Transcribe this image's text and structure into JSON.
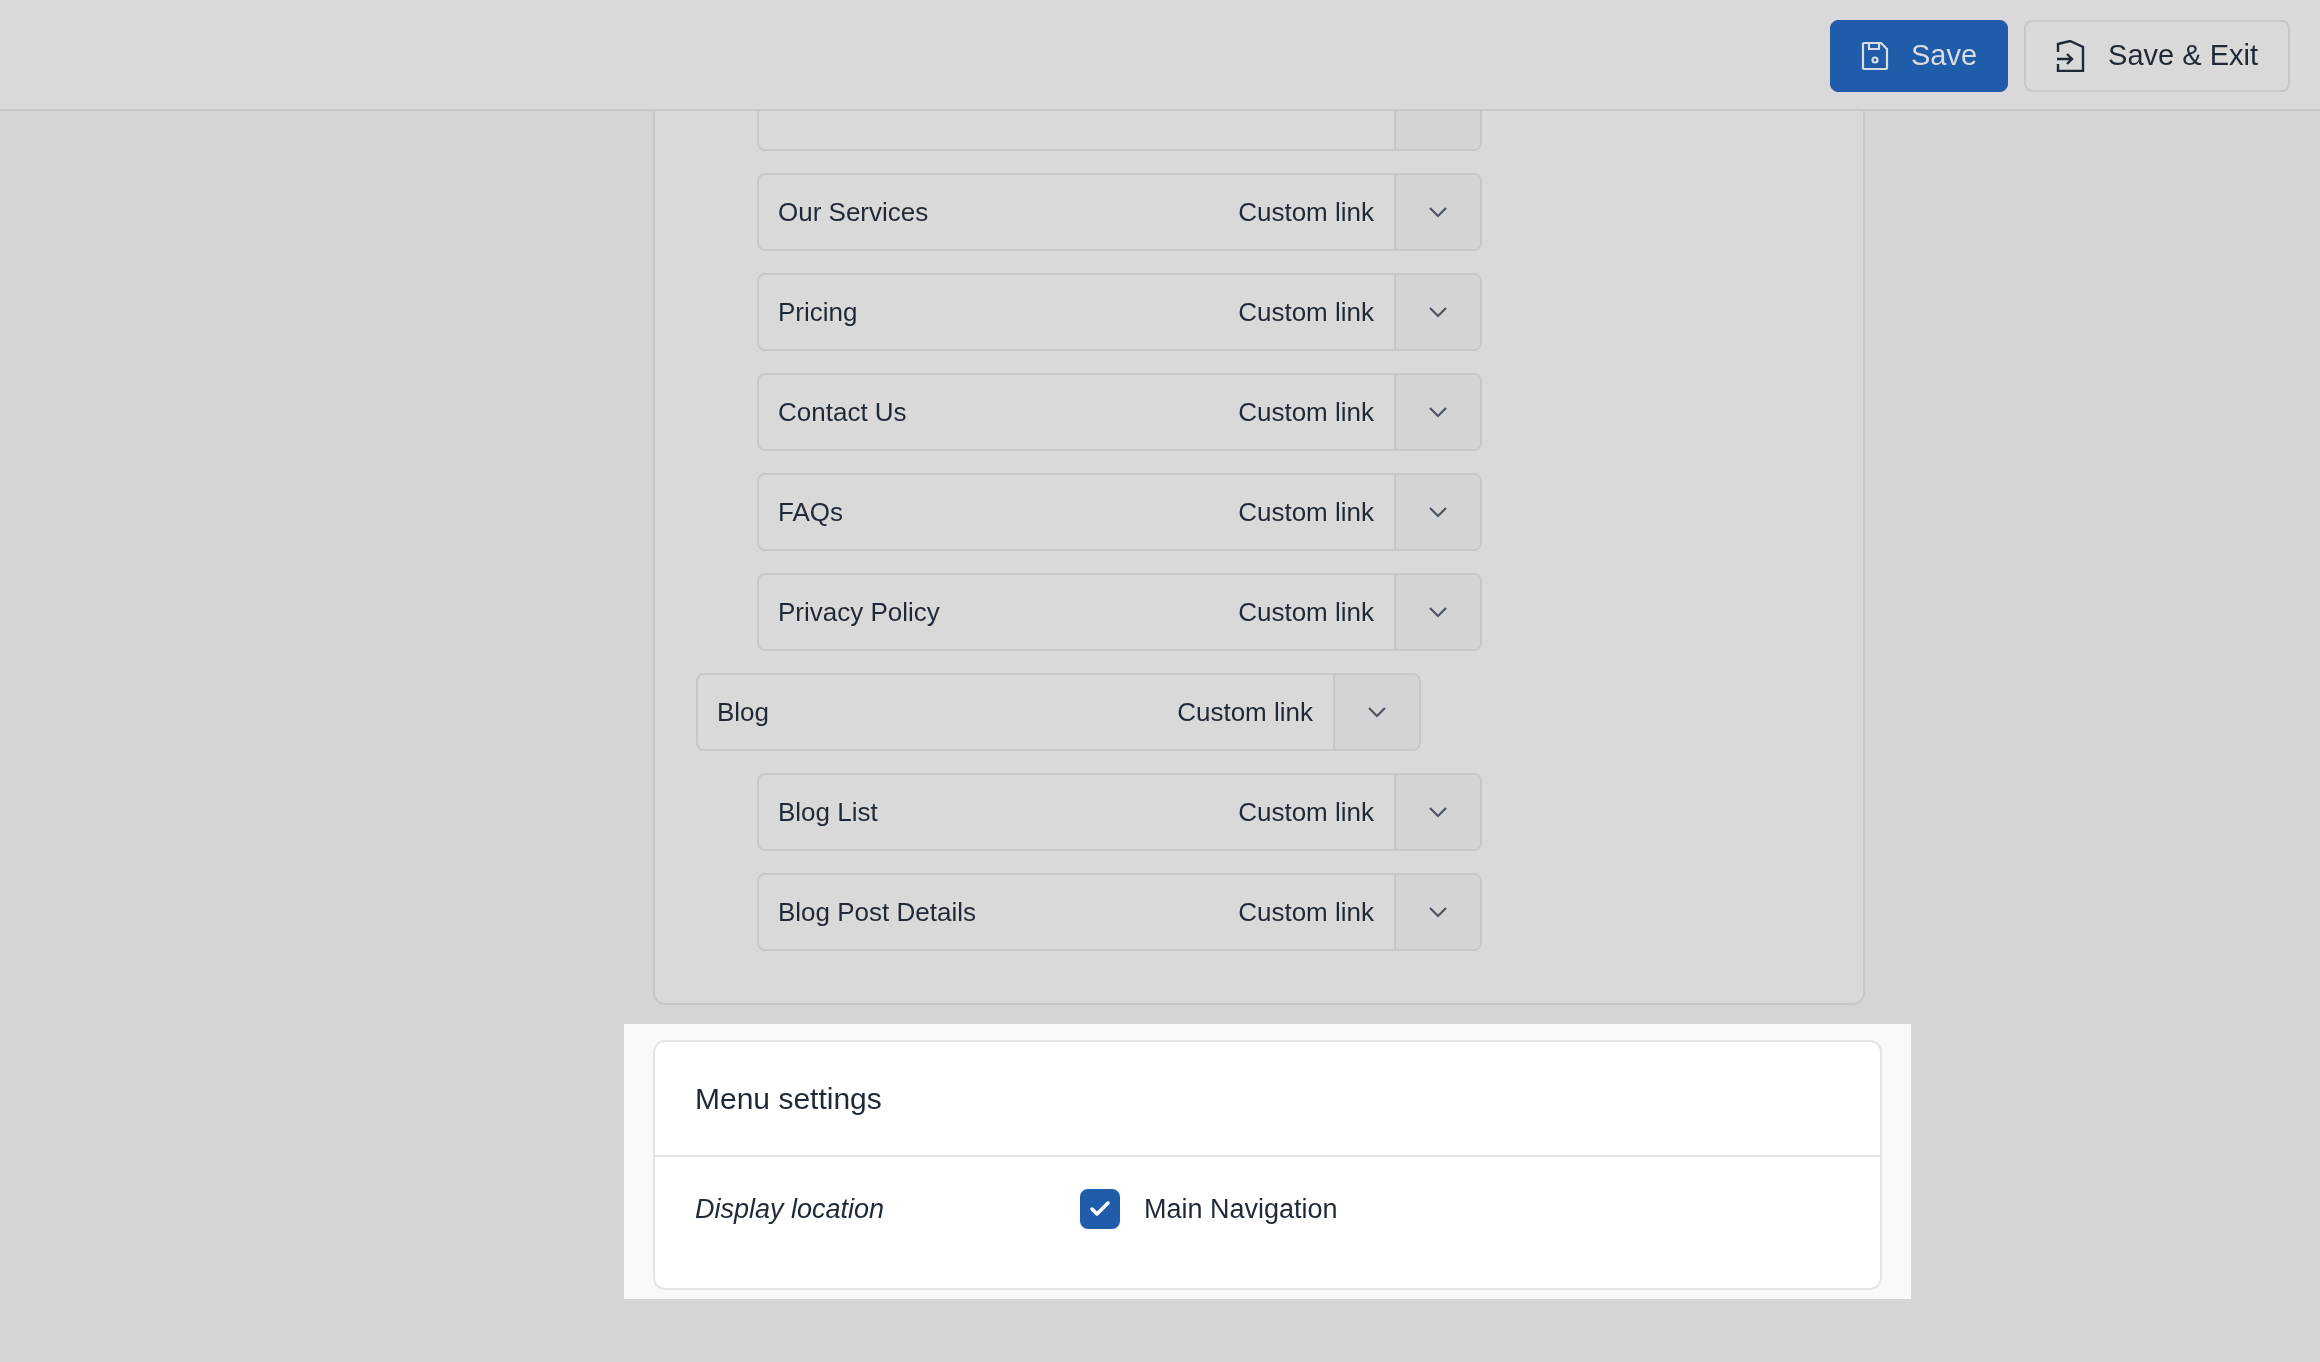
{
  "toolbar": {
    "buttons": [
      {
        "label": "Save",
        "kind": "primary"
      },
      {
        "label": "Save & Exit",
        "kind": "secondary"
      }
    ]
  },
  "menu_items": [
    {
      "children": [
        {
          "kind": "cut_off"
        },
        {
          "label": "Our Services",
          "type": "Custom link"
        },
        {
          "label": "Pricing",
          "type": "Custom link"
        },
        {
          "label": "Contact Us",
          "type": "Custom link"
        },
        {
          "label": "FAQs",
          "type": "Custom link"
        },
        {
          "label": "Privacy Policy",
          "type": "Custom link"
        }
      ]
    },
    {
      "label": "Blog",
      "type": "Custom link",
      "children": [
        {
          "label": "Blog List",
          "type": "Custom link"
        },
        {
          "label": "Blog Post Details",
          "type": "Custom link"
        }
      ]
    }
  ],
  "menu_settings": {
    "title": "Menu settings",
    "field_label": "Display location",
    "options": [
      {
        "label": "Main Navigation",
        "checked": true
      }
    ]
  }
}
